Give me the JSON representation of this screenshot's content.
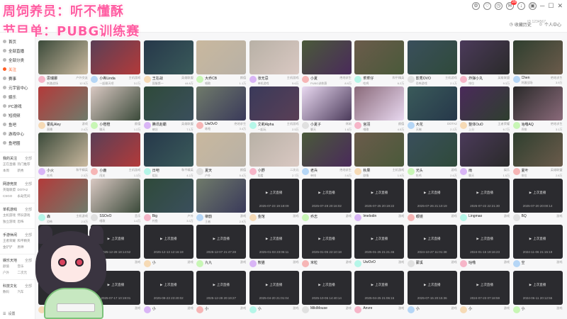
{
  "overlay": {
    "title_line1": "周饲养员：听不懂酥",
    "title_line2": "节目单：PUBG训练赛",
    "pill": "PUBG"
  },
  "topbar": {
    "badge": "28",
    "user_id": "ID 1234567",
    "links": [
      "收藏历史",
      "个人中心"
    ]
  },
  "sidebar": {
    "nav": [
      {
        "label": "首页",
        "active": false
      },
      {
        "label": "全部直播",
        "active": false
      },
      {
        "label": "全部分类",
        "active": false
      },
      {
        "label": "关注",
        "active": true
      },
      {
        "label": "赛事",
        "active": false
      },
      {
        "label": "元宇宙中心",
        "active": false
      },
      {
        "label": "娱乐",
        "active": false
      },
      {
        "label": "PC游戏",
        "active": false
      },
      {
        "label": "短视频",
        "active": false
      },
      {
        "label": "鱼吧",
        "active": false
      },
      {
        "label": "游戏中心",
        "active": false
      },
      {
        "label": "鱼吧圈",
        "active": false
      }
    ],
    "groups": [
      {
        "title": "我的关注",
        "more": "全部",
        "items": [
          "正在直播",
          "热门推荐",
          "本周",
          "新秀"
        ]
      },
      {
        "title": "网游竞技",
        "more": "全部",
        "items": [
          "英雄联盟",
          "DOTA2",
          "CSGO",
          "永劫无间"
        ]
      },
      {
        "title": "单机游戏",
        "more": "全部",
        "items": [
          "主机游戏",
          "怀旧游戏",
          "独立游戏",
          "恐怖"
        ]
      },
      {
        "title": "手游休闲",
        "more": "全部",
        "items": [
          "王者荣耀",
          "和平精英",
          "金铲铲",
          "原神"
        ]
      },
      {
        "title": "娱乐天地",
        "more": "全部",
        "items": [
          "颜值",
          "音乐",
          "户外",
          "二次元"
        ]
      },
      {
        "title": "科技文化",
        "more": "全部",
        "items": [
          "数码",
          "汽车"
        ]
      }
    ],
    "bottom_label": "设置"
  },
  "cards": [
    {
      "name": "思瑞娜",
      "cat": "户外交友",
      "title": "刺激战场",
      "views": "12.5万",
      "state": "live"
    },
    {
      "name": "小希Linda",
      "cat": "主机游戏",
      "title": "一起聊天吧",
      "views": "3.2万",
      "state": "live"
    },
    {
      "name": "王在战",
      "cat": "英雄联盟",
      "title": "国服第一",
      "views": "44.8万",
      "state": "live"
    },
    {
      "name": "大乔CB",
      "cat": "颜值",
      "title": "唱歌",
      "views": "1.1万",
      "state": "live"
    },
    {
      "name": "张无忌",
      "cat": "主机游戏",
      "title": "单机游戏",
      "views": "5.6万",
      "state": "live"
    },
    {
      "name": "小夏",
      "cat": "绝地求生",
      "title": "PUBG训练赛",
      "views": "8.9万",
      "state": "live"
    },
    {
      "name": "乖乖仔",
      "cat": "和平精英",
      "title": "吃鸡",
      "views": "6.2万",
      "state": "live"
    },
    {
      "name": "影秀OVO",
      "cat": "主机游戏",
      "title": "恐怖游戏",
      "views": "2.1万",
      "state": "live"
    },
    {
      "name": "炸弹小丸",
      "cat": "英雄联盟",
      "title": "排位",
      "views": "9.3万",
      "state": "live"
    },
    {
      "name": "Chen",
      "cat": "绝地求生",
      "title": "刺激战场",
      "views": "3.9万",
      "state": "live"
    },
    {
      "name": "霍乱Aley",
      "cat": "游戏",
      "title": "直播",
      "views": "2.4万",
      "state": "live"
    },
    {
      "name": "小橙橙",
      "cat": "颜值",
      "title": "聊天",
      "views": "1.2万",
      "state": "live"
    },
    {
      "name": "腾讯赵霸",
      "cat": "英雄联盟",
      "title": "峡谷",
      "views": "7.1万",
      "state": "live"
    },
    {
      "name": "UwOvO",
      "cat": "绝地求生",
      "title": "练枪",
      "views": "3.4万",
      "state": "live"
    },
    {
      "name": "艾莉Alpha",
      "cat": "主机游戏",
      "title": "一起玩",
      "views": "2.5万",
      "state": "live"
    },
    {
      "name": "小夏子",
      "cat": "休闲",
      "title": "聊天",
      "views": "1.8万",
      "state": "live"
    },
    {
      "name": "宫羽",
      "cat": "颜值",
      "title": "唱歌",
      "views": "4.5万",
      "state": "live"
    },
    {
      "name": "大花",
      "cat": "DOTA2",
      "title": "天梯",
      "views": "2.2万",
      "state": "live"
    },
    {
      "name": "整体OuO",
      "cat": "王者荣耀",
      "title": "上分",
      "views": "6.7万",
      "state": "live"
    },
    {
      "name": "咕噜AQ",
      "cat": "绝地求生",
      "title": "四排",
      "views": "3.1万",
      "state": "live"
    },
    {
      "name": "小火",
      "cat": "和平精英",
      "title": "吃鸡",
      "views": "2.3万",
      "state": "live"
    },
    {
      "name": "小鹿",
      "cat": "主机游戏",
      "title": "闯关",
      "views": "1.3万",
      "state": "live"
    },
    {
      "name": "日吧",
      "cat": "和平精英",
      "title": "组队",
      "views": "4.2万",
      "state": "live"
    },
    {
      "name": "夏天",
      "cat": "颜值",
      "title": "户外",
      "views": "5.4万",
      "state": "live"
    },
    {
      "name": "小野",
      "cat": "二次元",
      "title": "陪看",
      "views": "2.7万",
      "state": "live"
    },
    {
      "name": "老兵",
      "cat": "绝地求生",
      "title": "单排",
      "views": "3.6万",
      "state": "live"
    },
    {
      "name": "秋果",
      "cat": "主机游戏",
      "title": "剧情",
      "views": "1.9万",
      "state": "live"
    },
    {
      "name": "光头",
      "cat": "游戏",
      "title": "吃鸡",
      "views": "2.6万",
      "state": "live"
    },
    {
      "name": "雨",
      "cat": "娱乐",
      "title": "聊天",
      "views": "1.5万",
      "state": "live"
    },
    {
      "name": "夏叶",
      "cat": "英雄联盟",
      "title": "排位",
      "views": "2.8万",
      "state": "live"
    },
    {
      "name": "森",
      "cat": "主机游戏",
      "title": "恐怖",
      "views": "2.0万",
      "state": "live"
    },
    {
      "name": "SSOvO",
      "cat": "音乐",
      "title": "唱歌",
      "views": "1.4万",
      "state": "live"
    },
    {
      "name": "Big",
      "cat": "户外",
      "title": "钓鱼",
      "views": "3.3万",
      "state": "live"
    },
    {
      "name": "柳韵",
      "cat": "游戏",
      "title": "王者",
      "views": "2.9万",
      "state": "live"
    },
    {
      "name": "金馆",
      "cat": "游戏",
      "title": "上次直播",
      "views": "",
      "state": "off",
      "time": "2025-07-23 19:18:09"
    },
    {
      "name": "乔志",
      "cat": "游戏",
      "title": "上次直播",
      "views": "",
      "state": "off",
      "time": "2025-07-28 20:16:02"
    },
    {
      "name": "Imelodin",
      "cat": "游戏",
      "title": "上次直播",
      "views": "",
      "state": "off",
      "time": "2025-07-25 20:19:22"
    },
    {
      "name": "眼镜",
      "cat": "游戏",
      "title": "上次直播",
      "views": "",
      "state": "off",
      "time": "2025-07-26 21:10:19"
    },
    {
      "name": "Lingmao",
      "cat": "游戏",
      "title": "上次直播",
      "views": "",
      "state": "off",
      "time": "2025-07-22 22:21:30"
    },
    {
      "name": "BQ",
      "cat": "游戏",
      "title": "上次直播",
      "views": "",
      "state": "off",
      "time": "2025-07-20 20:00:14"
    },
    {
      "name": "小",
      "cat": "游戏",
      "title": "上次直播",
      "views": "",
      "state": "off",
      "time": "2025-12-20 16:22:44"
    },
    {
      "name": "小",
      "cat": "游戏",
      "title": "上次直播",
      "views": "",
      "state": "off",
      "time": "2025-12-28 18:14:52"
    },
    {
      "name": "小",
      "cat": "游戏",
      "title": "上次直播",
      "views": "",
      "state": "off",
      "time": "2025-12-13 12:16:19"
    },
    {
      "name": "九九",
      "cat": "游戏",
      "title": "上次直播",
      "views": "",
      "state": "off",
      "time": "2025-12-07 21:47:28"
    },
    {
      "name": "熊猫",
      "cat": "游戏",
      "title": "上次直播",
      "views": "",
      "state": "off",
      "time": "2025-01-03 23:06:11"
    },
    {
      "name": "米粒",
      "cat": "游戏",
      "title": "上次直播",
      "views": "",
      "state": "off",
      "time": "2025-01-05 22:10:18"
    },
    {
      "name": "UwOvO",
      "cat": "游戏",
      "title": "上次直播",
      "views": "",
      "state": "off",
      "time": "2025-01-25 21:21:46"
    },
    {
      "name": "蒙溪",
      "cat": "游戏",
      "title": "上次直播",
      "views": "",
      "state": "off",
      "time": "2024-10-27 11:01:38"
    },
    {
      "name": "咕噜",
      "cat": "游戏",
      "title": "上次直播",
      "views": "",
      "state": "off",
      "time": "2024-01-15 19:16:23"
    },
    {
      "name": "空",
      "cat": "游戏",
      "title": "上次直播",
      "views": "",
      "state": "off",
      "time": "2024-11-06 21:15:19"
    },
    {
      "name": "小",
      "cat": "游戏",
      "title": "上次直播",
      "views": "",
      "state": "off",
      "time": "2025-10-16 09:56:02"
    },
    {
      "name": "小",
      "cat": "游戏",
      "title": "上次直播",
      "views": "",
      "state": "off",
      "time": "2025-07-17 10:19:01"
    },
    {
      "name": "小",
      "cat": "游戏",
      "title": "上次直播",
      "views": "",
      "state": "off",
      "time": "2025-08-23 23:20:02"
    },
    {
      "name": "小",
      "cat": "游戏",
      "title": "上次直播",
      "views": "",
      "state": "off",
      "time": "2025-12-28 20:19:27"
    },
    {
      "name": "小",
      "cat": "游戏",
      "title": "上次直播",
      "views": "",
      "state": "off",
      "time": "2025-04-20 21:01:04"
    },
    {
      "name": "MikiMouse",
      "cat": "游戏",
      "title": "上次直播",
      "views": "",
      "state": "off",
      "time": "2025-10-06 14:40:14"
    },
    {
      "name": "Anvre",
      "cat": "游戏",
      "title": "上次直播",
      "views": "",
      "state": "off",
      "time": "2025-04-25 21:06:15"
    },
    {
      "name": "小",
      "cat": "游戏",
      "title": "上次直播",
      "views": "",
      "state": "off",
      "time": "2025-07-15 20:15:36"
    },
    {
      "name": "小",
      "cat": "游戏",
      "title": "上次直播",
      "views": "",
      "state": "off",
      "time": "2024-07-23 07:18:59"
    },
    {
      "name": "小",
      "cat": "游戏",
      "title": "上次直播",
      "views": "",
      "state": "off",
      "time": "2024-06-11 20:12:55"
    }
  ]
}
